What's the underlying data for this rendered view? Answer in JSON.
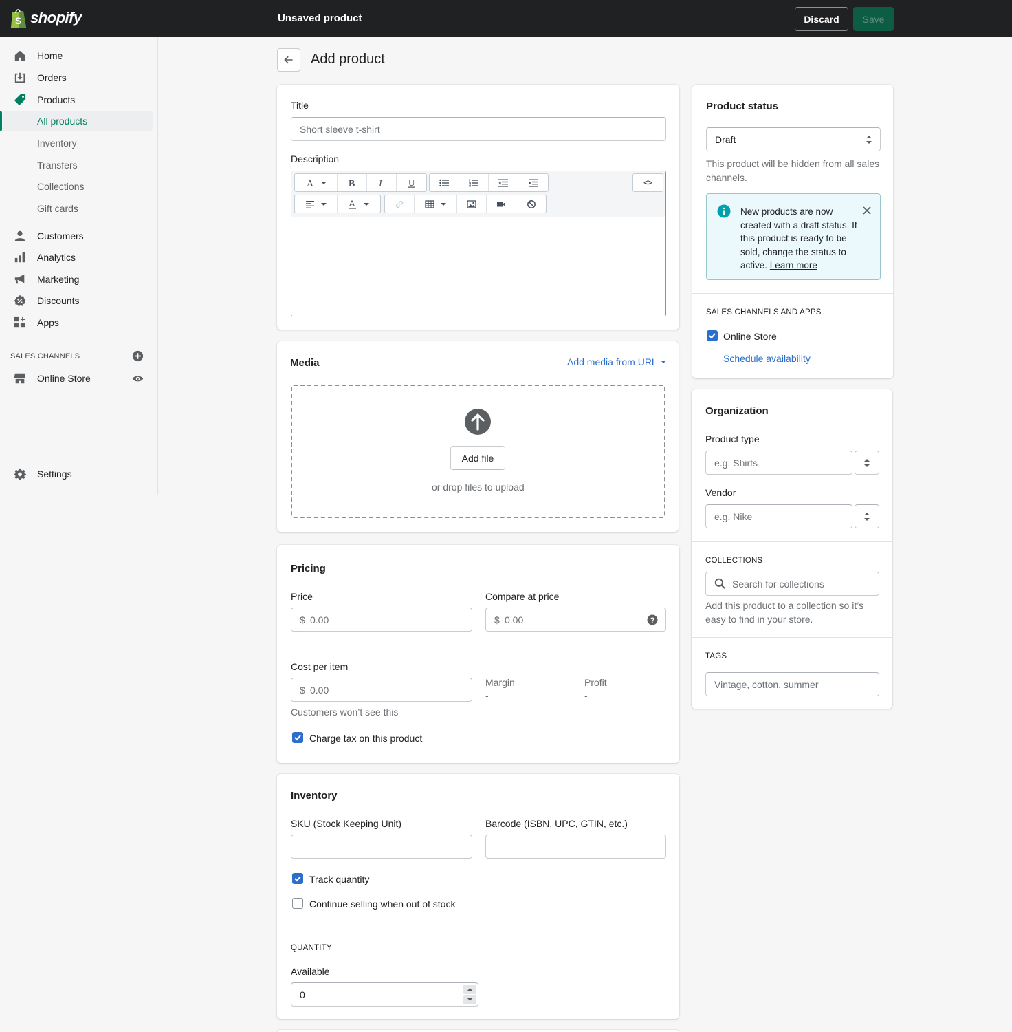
{
  "topbar": {
    "brand": "shopify",
    "title": "Unsaved product",
    "discard_label": "Discard",
    "save_label": "Save"
  },
  "sidebar": {
    "items": [
      {
        "label": "Home",
        "icon": "home-icon"
      },
      {
        "label": "Orders",
        "icon": "orders-icon"
      },
      {
        "label": "Products",
        "icon": "tag-icon"
      },
      {
        "label": "Customers",
        "icon": "person-icon"
      },
      {
        "label": "Analytics",
        "icon": "bar-chart-icon"
      },
      {
        "label": "Marketing",
        "icon": "megaphone-icon"
      },
      {
        "label": "Discounts",
        "icon": "discount-icon"
      },
      {
        "label": "Apps",
        "icon": "apps-icon"
      }
    ],
    "sub_items": [
      "All products",
      "Inventory",
      "Transfers",
      "Collections",
      "Gift cards"
    ],
    "sales_channels_heading": "SALES CHANNELS",
    "online_store": "Online Store",
    "settings": "Settings"
  },
  "page": {
    "title": "Add product"
  },
  "title_card": {
    "title_label": "Title",
    "title_placeholder": "Short sleeve t-shirt",
    "description_label": "Description",
    "code_btn": "<>"
  },
  "media": {
    "title": "Media",
    "add_from_url": "Add media from URL",
    "add_file": "Add file",
    "drop_text": "or drop files to upload"
  },
  "pricing": {
    "title": "Pricing",
    "price_label": "Price",
    "compare_label": "Compare at price",
    "currency": "$",
    "price_placeholder": "0.00",
    "compare_placeholder": "0.00",
    "cost_label": "Cost per item",
    "cost_placeholder": "0.00",
    "cost_help": "Customers won’t see this",
    "margin_label": "Margin",
    "margin_value": "-",
    "profit_label": "Profit",
    "profit_value": "-",
    "charge_tax_label": "Charge tax on this product",
    "charge_tax_checked": true
  },
  "inventory": {
    "title": "Inventory",
    "sku_label": "SKU (Stock Keeping Unit)",
    "barcode_label": "Barcode (ISBN, UPC, GTIN, etc.)",
    "track_quantity_label": "Track quantity",
    "track_quantity_checked": true,
    "continue_selling_label": "Continue selling when out of stock",
    "continue_selling_checked": false,
    "quantity_heading": "QUANTITY",
    "available_label": "Available",
    "available_value": "0"
  },
  "status": {
    "title": "Product status",
    "selected": "Draft",
    "help": "This product will be hidden from all sales channels.",
    "banner_text": "New products are now created with a draft status. If this product is ready to be sold, change the status to active.",
    "banner_link": "Learn more",
    "channels_heading": "SALES CHANNELS AND APPS",
    "channel_online_store": "Online Store",
    "schedule_link": "Schedule availability"
  },
  "organization": {
    "title": "Organization",
    "product_type_label": "Product type",
    "product_type_placeholder": "e.g. Shirts",
    "vendor_label": "Vendor",
    "vendor_placeholder": "e.g. Nike",
    "collections_heading": "COLLECTIONS",
    "collections_placeholder": "Search for collections",
    "collections_help": "Add this product to a collection so it’s easy to find in your store.",
    "tags_heading": "TAGS",
    "tags_placeholder": "Vintage, cotton, summer"
  },
  "colors": {
    "accent_green": "#008060",
    "link_blue": "#2c6ecb",
    "topbar": "#202123"
  }
}
